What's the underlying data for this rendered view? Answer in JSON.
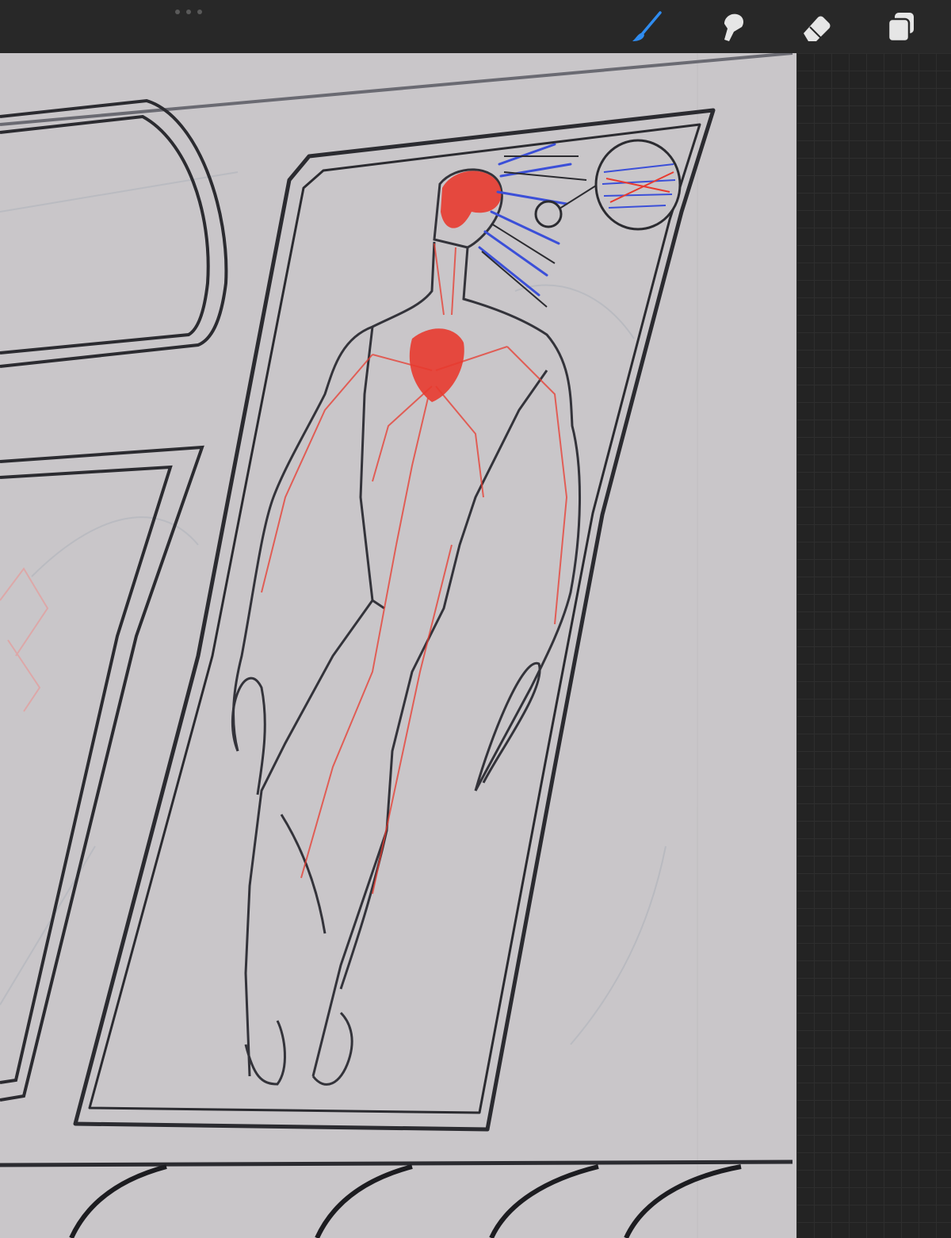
{
  "app": {
    "accent_color": "#2f8cf0",
    "canvas_color": "#c9c6c9",
    "chrome_color": "#282828"
  },
  "toolbar": {
    "tools": [
      {
        "id": "brush",
        "icon": "brush-icon",
        "active": true
      },
      {
        "id": "smudge",
        "icon": "smudge-icon",
        "active": false
      },
      {
        "id": "eraser",
        "icon": "eraser-icon",
        "active": false
      },
      {
        "id": "layers",
        "icon": "layers-icon",
        "active": false
      }
    ]
  },
  "artwork": {
    "subject": "sketch",
    "stroke_color": "#2b2b30",
    "highlight_color": "#e83a2f",
    "secondary_color": "#3b4fd8"
  }
}
